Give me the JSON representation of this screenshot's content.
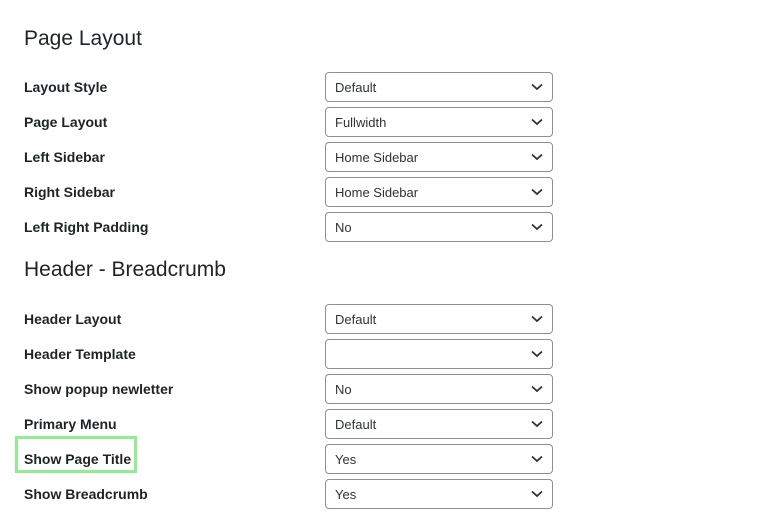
{
  "sections": [
    {
      "title": "Page Layout",
      "fields": [
        {
          "label": "Layout Style",
          "value": "Default"
        },
        {
          "label": "Page Layout",
          "value": "Fullwidth"
        },
        {
          "label": "Left Sidebar",
          "value": "Home Sidebar"
        },
        {
          "label": "Right Sidebar",
          "value": "Home Sidebar"
        },
        {
          "label": "Left Right Padding",
          "value": "No"
        }
      ]
    },
    {
      "title": "Header - Breadcrumb",
      "fields": [
        {
          "label": "Header Layout",
          "value": "Default"
        },
        {
          "label": "Header Template",
          "value": ""
        },
        {
          "label": "Show popup newletter",
          "value": "No"
        },
        {
          "label": "Primary Menu",
          "value": "Default"
        },
        {
          "label": "Show Page Title",
          "value": "Yes"
        },
        {
          "label": "Show Breadcrumb",
          "value": "Yes"
        }
      ]
    }
  ],
  "highlight": {
    "target": "Show Page Title",
    "color": "#90ee90"
  },
  "icons": {
    "select_arrow": "chevron-down-icon"
  }
}
